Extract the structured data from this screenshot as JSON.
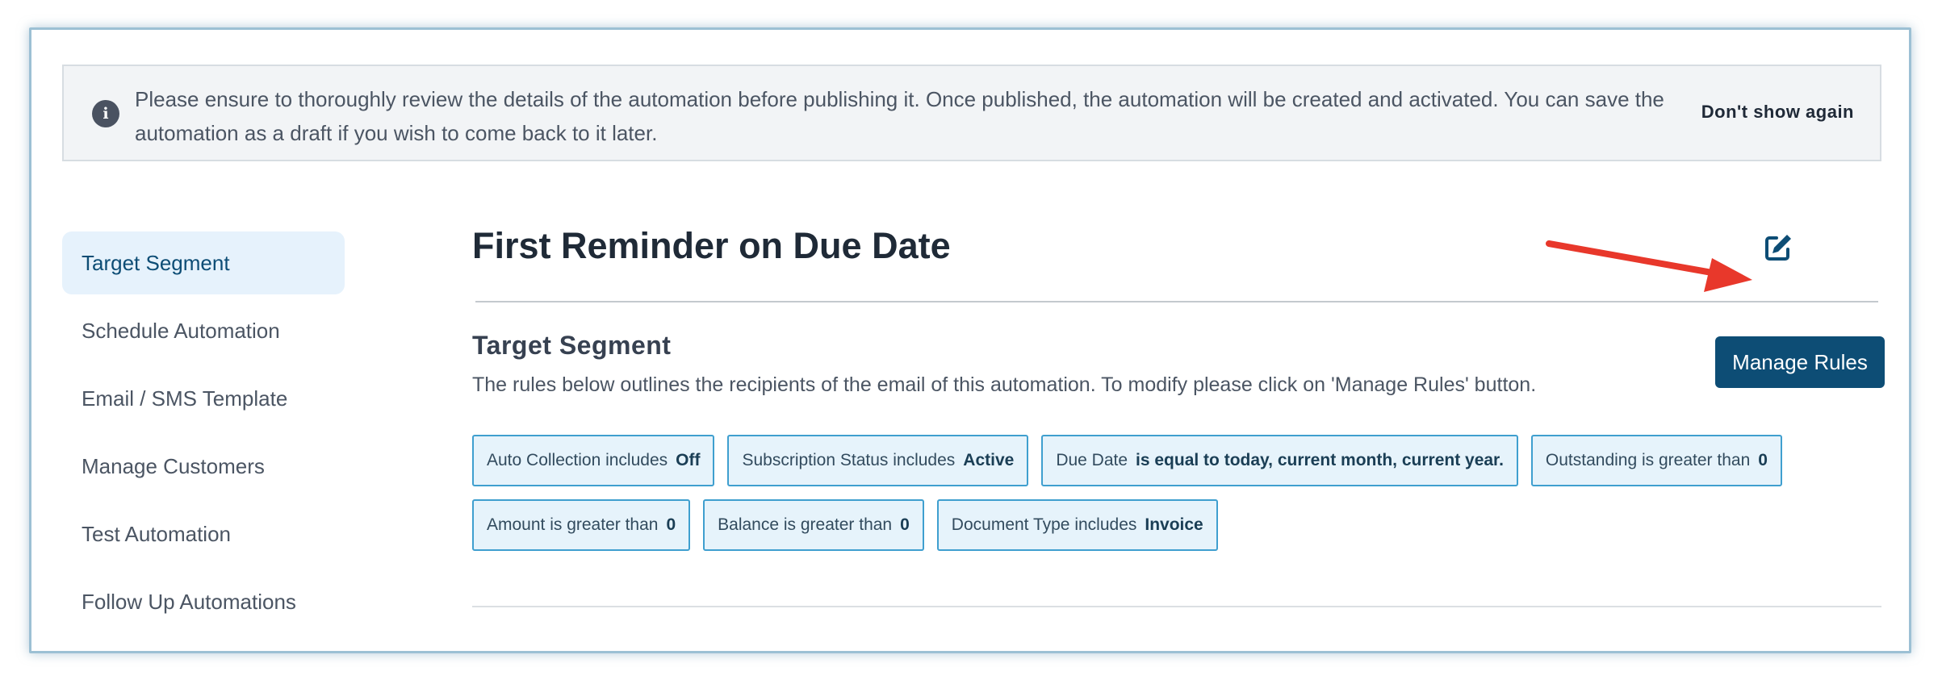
{
  "notice": {
    "text": "Please ensure to thoroughly review the details of the automation before publishing it. Once published, the automation will be created and activated. You can save the automation as a draft if you wish to come back to it later.",
    "dismiss_label": "Don't show again",
    "icon": "info-icon"
  },
  "sidebar": {
    "items": [
      {
        "label": "Target Segment",
        "active": true
      },
      {
        "label": "Schedule Automation"
      },
      {
        "label": "Email / SMS Template"
      },
      {
        "label": "Manage Customers"
      },
      {
        "label": "Test Automation"
      },
      {
        "label": "Follow Up Automations"
      }
    ]
  },
  "main": {
    "title": "First Reminder on Due Date",
    "edit_icon": "pencil-square-icon",
    "section": {
      "title": "Target Segment",
      "description": "The rules below outlines the recipients of the email of this automation. To modify please click on 'Manage Rules' button.",
      "button_label": "Manage Rules"
    },
    "rules": [
      {
        "label": "Auto Collection includes",
        "value": "Off"
      },
      {
        "label": "Subscription Status includes",
        "value": "Active"
      },
      {
        "label": "Due Date",
        "value": "is equal to today, current month, current year."
      },
      {
        "label": "Outstanding is greater than",
        "value": "0"
      },
      {
        "label": "Amount is greater than",
        "value": "0"
      },
      {
        "label": "Balance is greater than",
        "value": "0"
      },
      {
        "label": "Document Type includes",
        "value": "Invoice"
      }
    ]
  },
  "colors": {
    "accent": "#0d4d75",
    "chip_border": "#3f9fcf",
    "chip_bg": "#e6f3fb",
    "sidebar_active_bg": "#e6f2fc",
    "annotation_arrow": "#e8382b"
  }
}
